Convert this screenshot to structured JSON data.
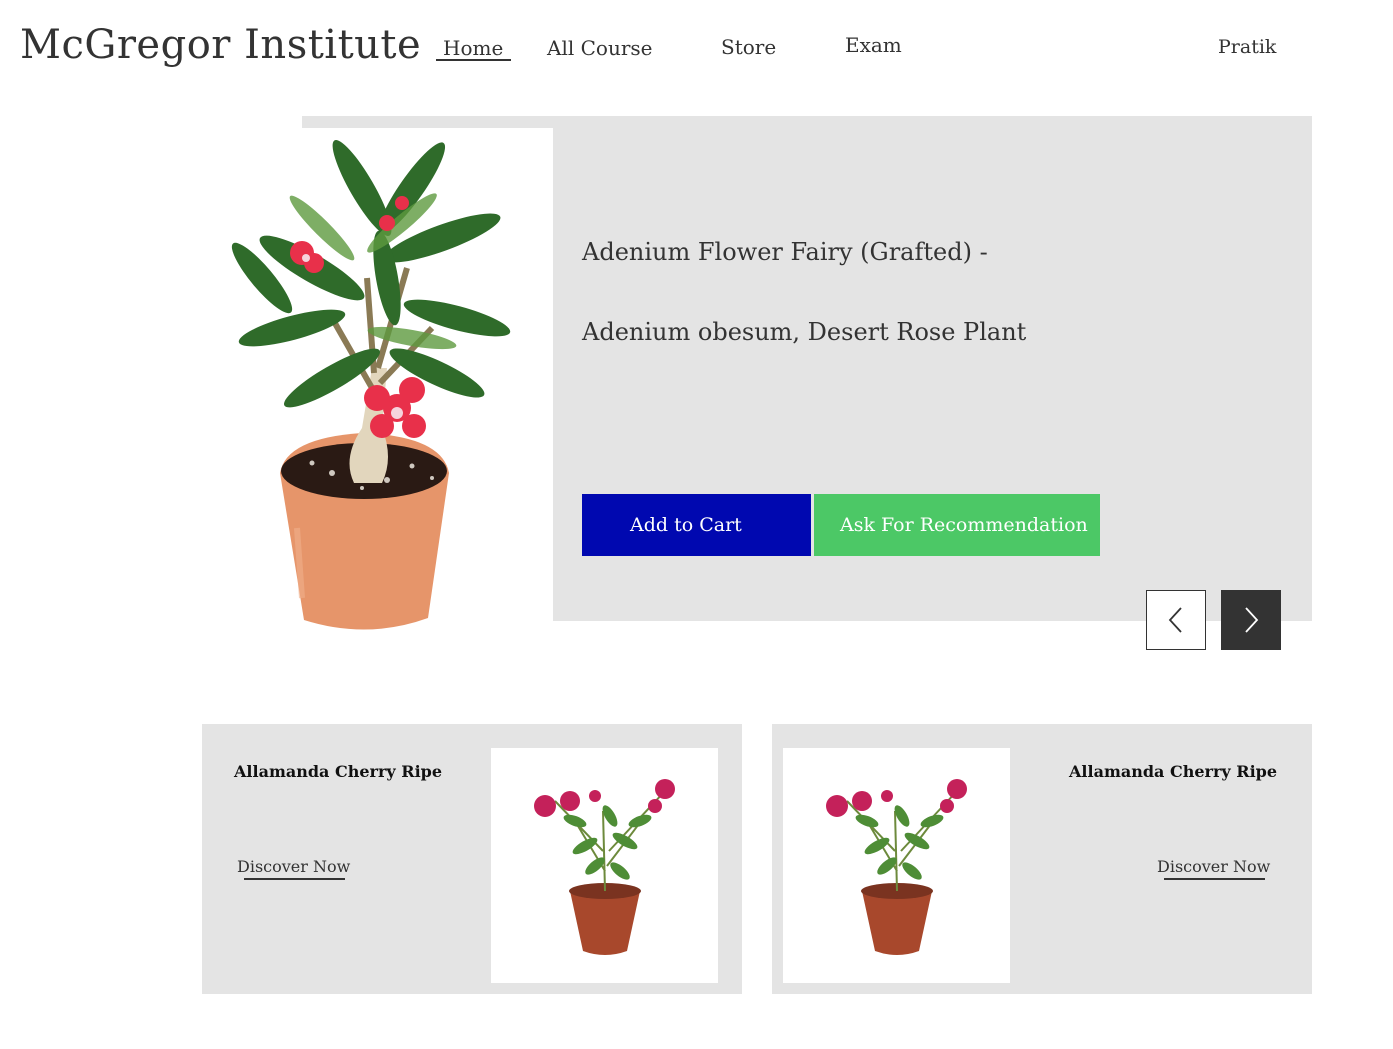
{
  "header": {
    "brand": "McGregor Institute",
    "nav": [
      "Home",
      "All Course",
      "Store",
      "Exam"
    ],
    "user": "Pratik"
  },
  "hero": {
    "title_line1": "Adenium Flower Fairy (Grafted) -",
    "title_line2": "Adenium obesum, Desert Rose Plant",
    "add_to_cart": "Add to Cart",
    "recommend": "Ask For Recommendation",
    "image_icon": "adenium-plant-image",
    "prev_icon": "chevron-left-icon",
    "next_icon": "chevron-right-icon"
  },
  "cards": [
    {
      "title": "Allamanda Cherry Ripe",
      "link": "Discover Now",
      "image_icon": "allamanda-plant-image"
    },
    {
      "title": "Allamanda Cherry Ripe",
      "link": "Discover Now",
      "image_icon": "allamanda-plant-image"
    }
  ],
  "colors": {
    "panel": "#e4e4e4",
    "add_to_cart": "#0008b0",
    "recommend": "#4cc866",
    "next_button": "#333333",
    "text": "#333333"
  }
}
